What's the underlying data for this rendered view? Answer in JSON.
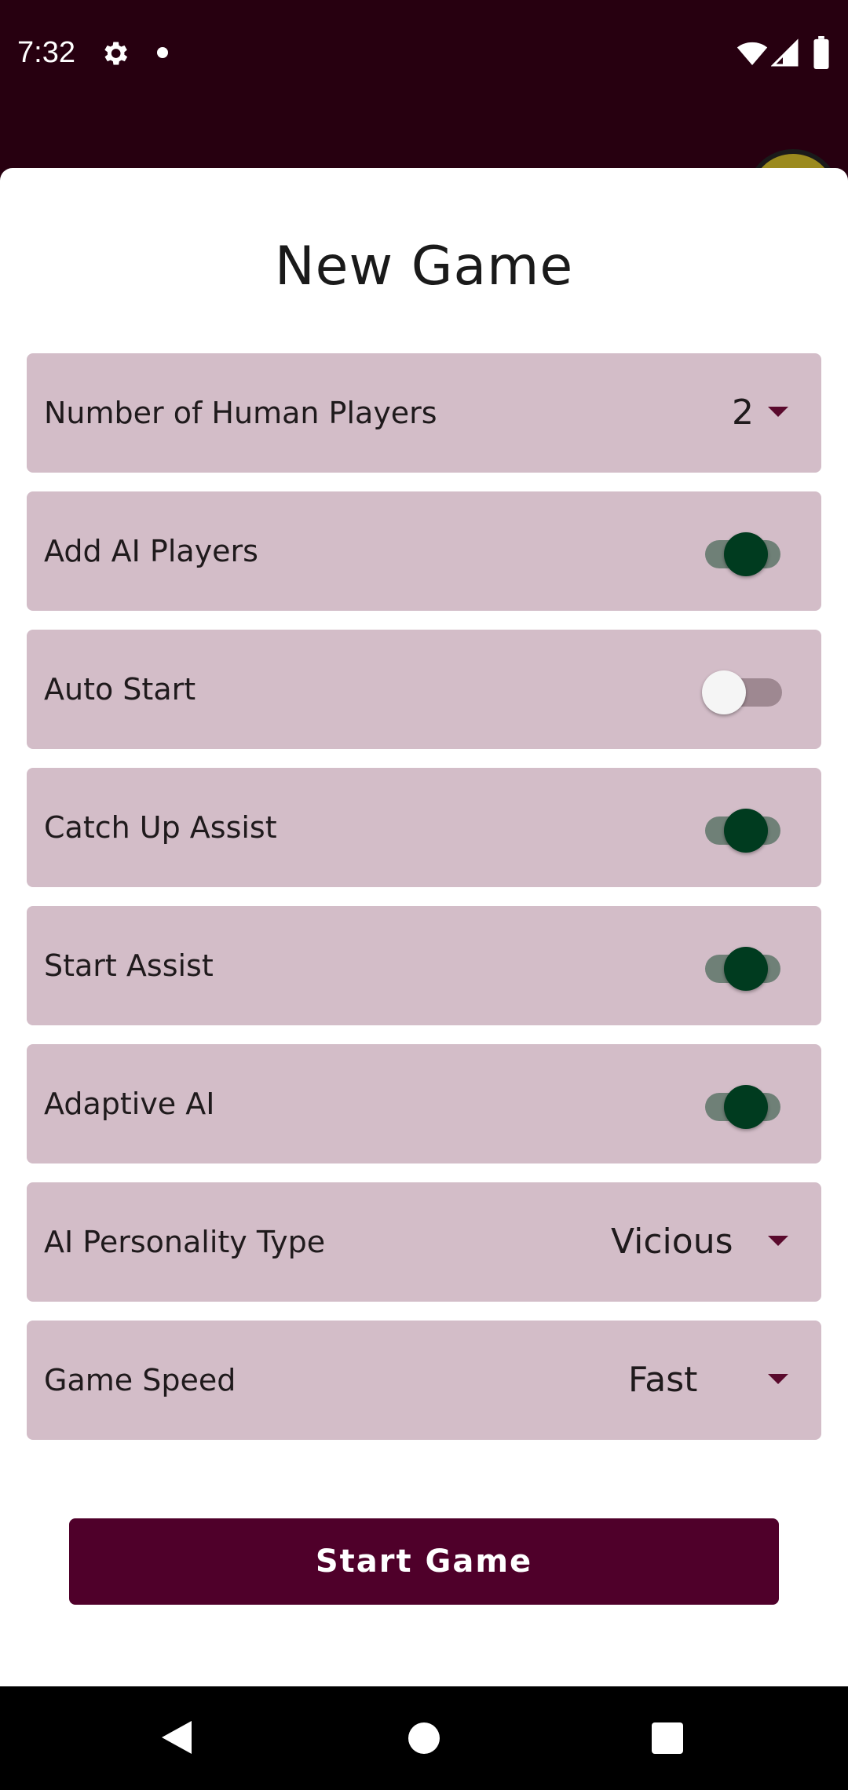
{
  "status_bar": {
    "time": "7:32",
    "icons": [
      "gear-icon",
      "notification-dot-icon",
      "wifi-icon",
      "signal-icon",
      "battery-icon"
    ]
  },
  "dialog": {
    "title": "New Game",
    "rows": [
      {
        "label": "Number of Human Players",
        "type": "dropdown",
        "value": "2"
      },
      {
        "label": "Add AI Players",
        "type": "toggle",
        "checked": true
      },
      {
        "label": "Auto Start",
        "type": "toggle",
        "checked": false
      },
      {
        "label": "Catch Up Assist",
        "type": "toggle",
        "checked": true
      },
      {
        "label": "Start Assist",
        "type": "toggle",
        "checked": true
      },
      {
        "label": "Adaptive AI",
        "type": "toggle",
        "checked": true
      },
      {
        "label": "AI Personality Type",
        "type": "dropdown",
        "value": "Vicious"
      },
      {
        "label": "Game Speed",
        "type": "dropdown",
        "value": "Fast"
      }
    ],
    "start_button_label": "Start Game"
  },
  "colors": {
    "app_bar": "#270010",
    "row_background": "#d3bdc8",
    "accent": "#4f002a",
    "toggle_on_thumb": "#003b1f"
  }
}
